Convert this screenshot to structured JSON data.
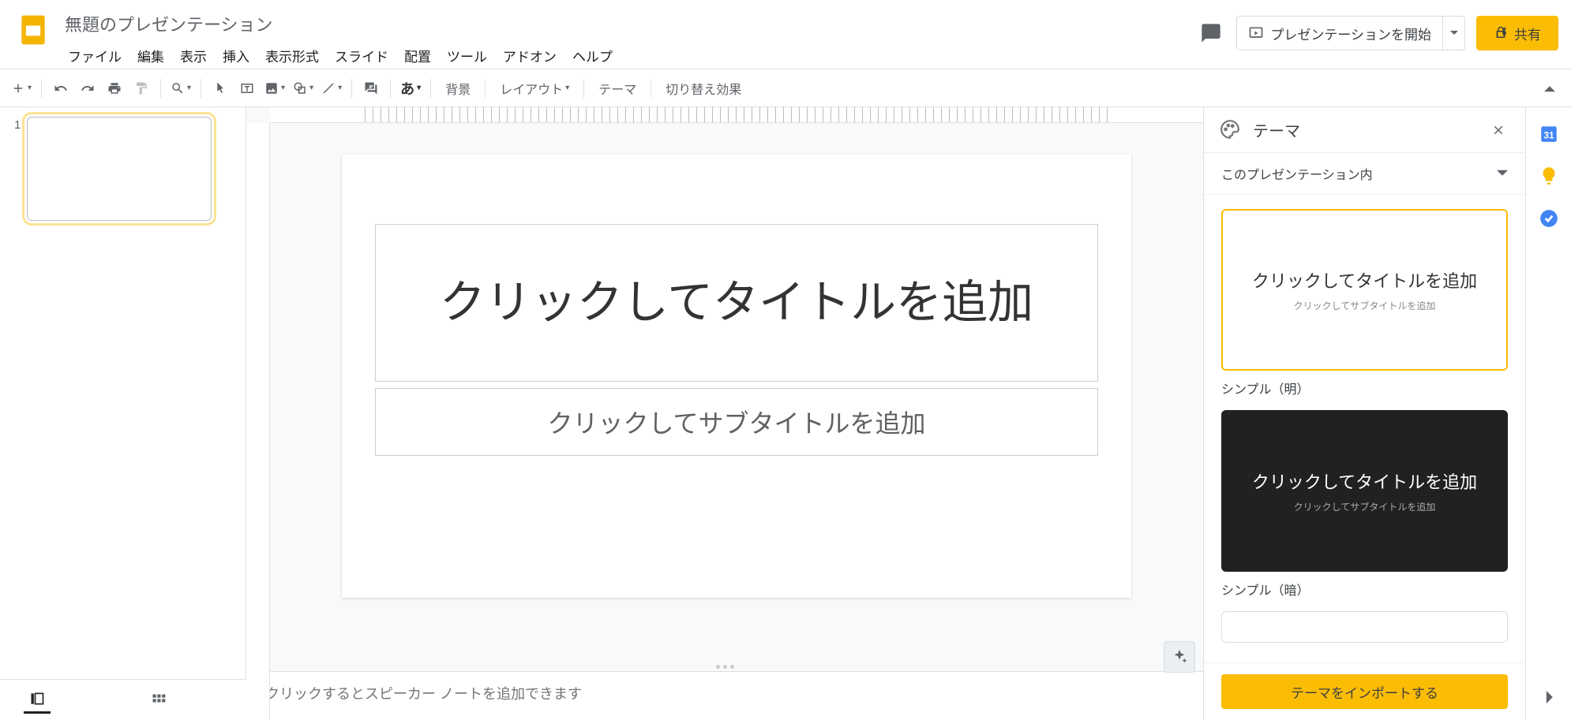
{
  "header": {
    "doc_title": "無題のプレゼンテーション",
    "menus": [
      "ファイル",
      "編集",
      "表示",
      "挿入",
      "表示形式",
      "スライド",
      "配置",
      "ツール",
      "アドオン",
      "ヘルプ"
    ],
    "present_label": "プレゼンテーションを開始",
    "share_label": "共有"
  },
  "toolbar": {
    "background": "背景",
    "layout": "レイアウト",
    "theme": "テーマ",
    "transition": "切り替え効果",
    "input_tool": "あ"
  },
  "filmstrip": {
    "slides": [
      {
        "num": "1"
      }
    ]
  },
  "slide": {
    "title_placeholder": "クリックしてタイトルを追加",
    "subtitle_placeholder": "クリックしてサブタイトルを追加"
  },
  "notes": {
    "placeholder": "クリックするとスピーカー ノートを追加できます"
  },
  "theme_panel": {
    "title": "テーマ",
    "section": "このプレゼンテーション内",
    "preview_title": "クリックしてタイトルを追加",
    "preview_sub": "クリックしてサブタイトルを追加",
    "themes": [
      {
        "name": "シンプル（明）",
        "variant": "light",
        "selected": true
      },
      {
        "name": "シンプル（暗）",
        "variant": "dark",
        "selected": false
      }
    ],
    "import_label": "テーマをインポートする"
  }
}
